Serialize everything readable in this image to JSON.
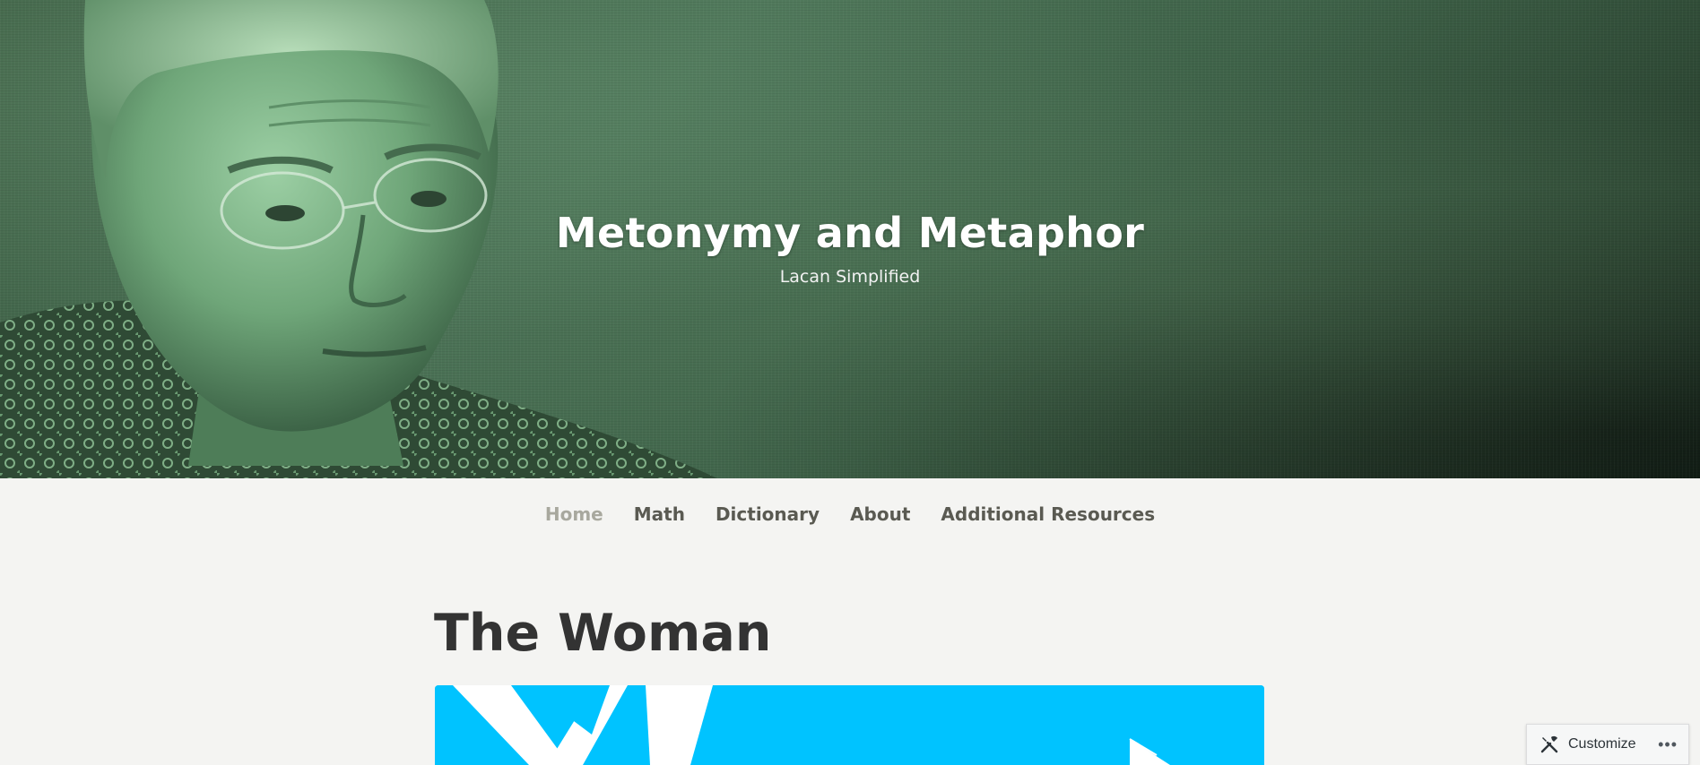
{
  "header": {
    "site_title": "Metonymy and Metaphor",
    "tagline": "Lacan Simplified"
  },
  "nav": {
    "items": [
      {
        "label": "Home",
        "active": true
      },
      {
        "label": "Math",
        "active": false
      },
      {
        "label": "Dictionary",
        "active": false
      },
      {
        "label": "About",
        "active": false
      },
      {
        "label": "Additional Resources",
        "active": false
      }
    ]
  },
  "post": {
    "title": "The Woman",
    "featured_image_color": "#00c3ff"
  },
  "customize_bar": {
    "label": "Customize",
    "more_label": "•••",
    "icon": "tools-icon"
  },
  "colors": {
    "header_green": "#4b7256",
    "page_bg": "#f4f4f2",
    "nav_text": "#5a5a52",
    "nav_active": "#a8a89e",
    "title_text": "#333333"
  }
}
